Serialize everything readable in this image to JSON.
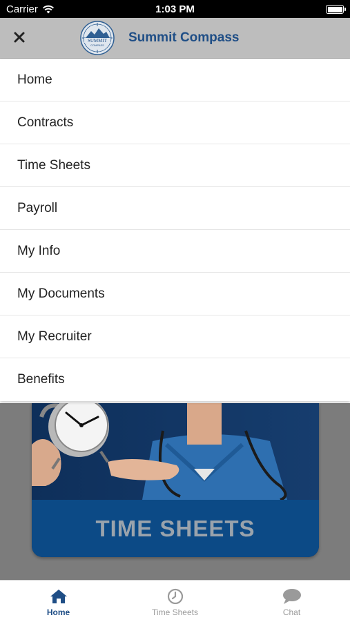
{
  "status_bar": {
    "carrier": "Carrier",
    "time": "1:03 PM"
  },
  "header": {
    "brand": "Summit Compass",
    "logo_text_top": "SUMMIT",
    "logo_text_bottom": "COMPASS"
  },
  "menu": {
    "items": [
      {
        "label": "Home"
      },
      {
        "label": "Contracts"
      },
      {
        "label": "Time Sheets"
      },
      {
        "label": "Payroll"
      },
      {
        "label": "My Info"
      },
      {
        "label": "My Documents"
      },
      {
        "label": "My Recruiter"
      },
      {
        "label": "Benefits"
      }
    ]
  },
  "card": {
    "title": "TIME SHEETS"
  },
  "tabbar": {
    "tabs": [
      {
        "label": "Home",
        "icon": "home-icon",
        "active": true
      },
      {
        "label": "Time Sheets",
        "icon": "clock-icon",
        "active": false
      },
      {
        "label": "Chat",
        "icon": "chat-bubble-icon",
        "active": false
      }
    ]
  },
  "colors": {
    "brand_blue": "#1f4e86",
    "header_gray": "#bdbdbd",
    "banner_blue": "#0c4a86",
    "inactive_gray": "#9a9a9a"
  }
}
